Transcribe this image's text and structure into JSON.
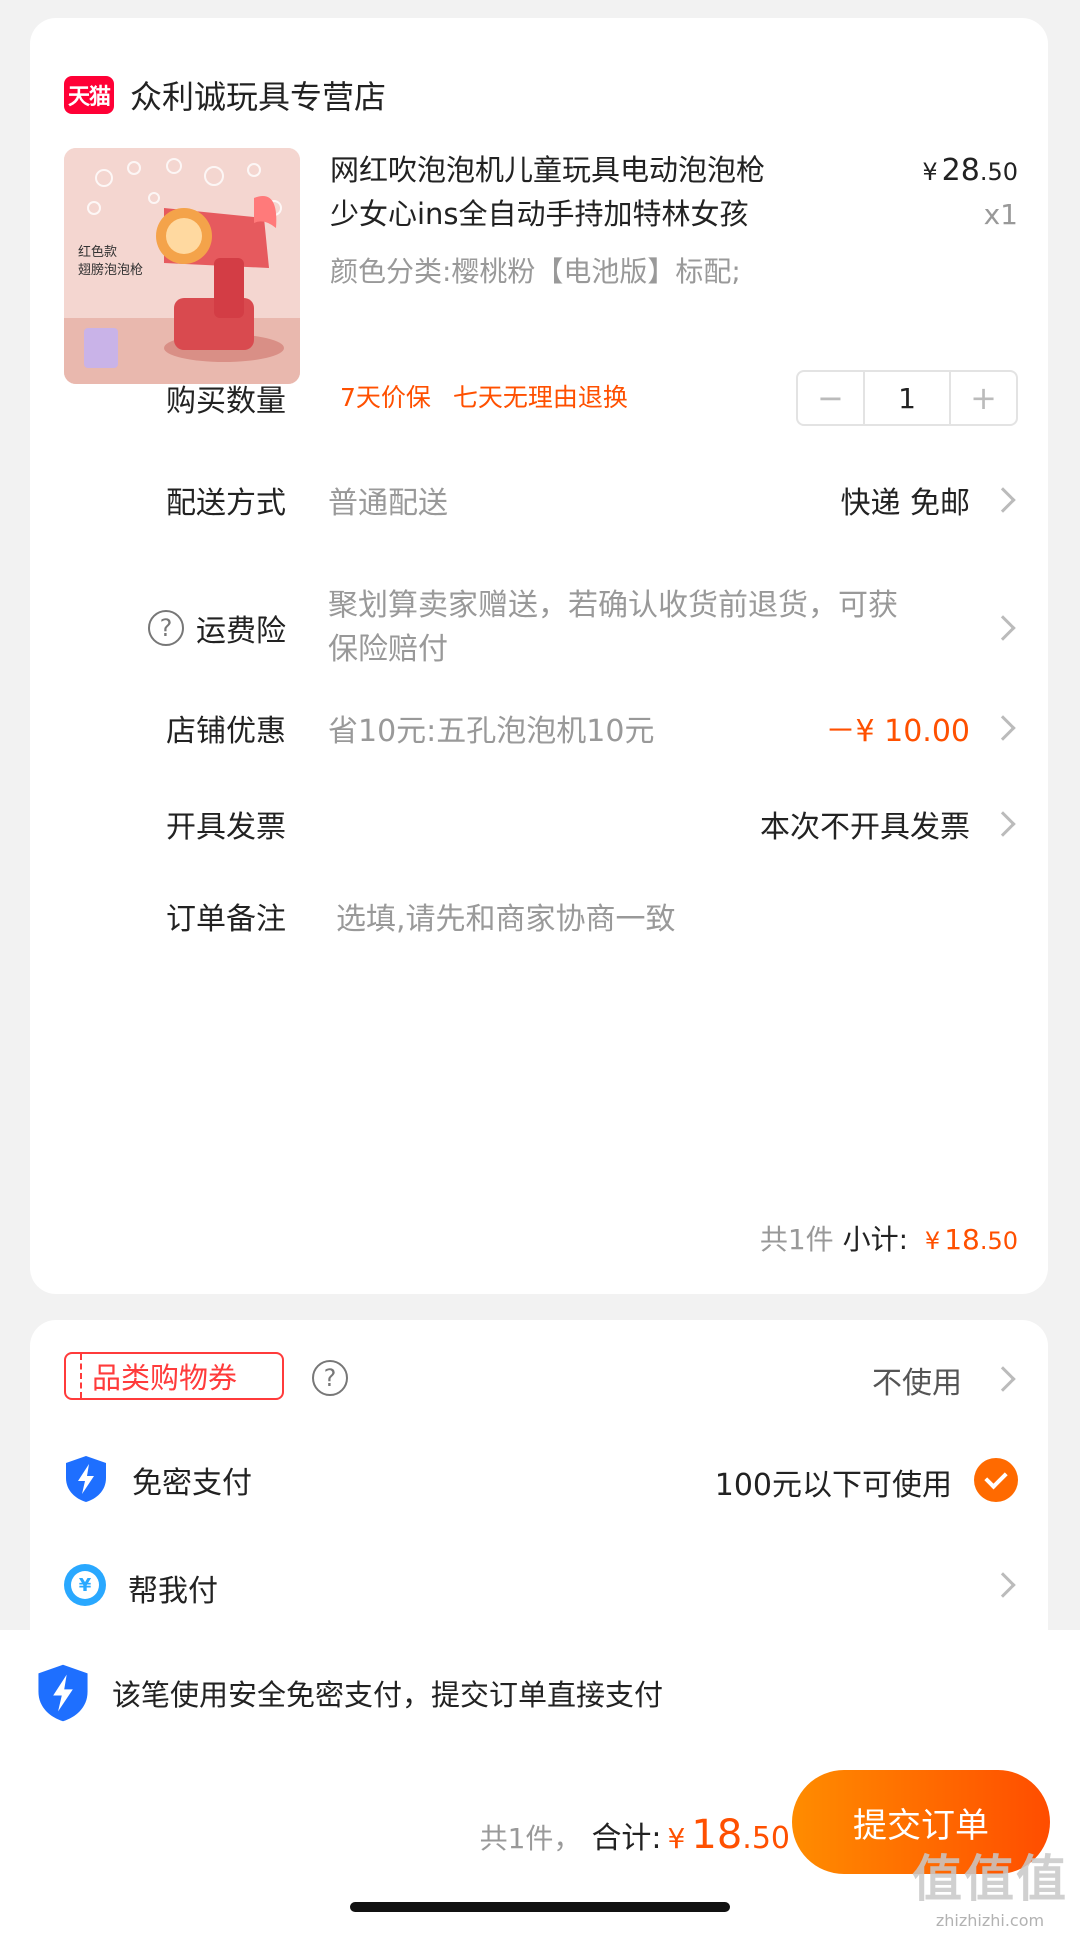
{
  "store": {
    "badge": "天猫",
    "name": "众利诚玩具专营店"
  },
  "product": {
    "title": "网红吹泡泡机儿童玩具电动泡泡枪少女心ins全自动手持加特林女孩",
    "price_yen": "¥",
    "price_main": "28",
    "price_decimal": ".50",
    "quantity_label": "x1",
    "spec": "颜色分类:樱桃粉【电池版】标配;",
    "tags": [
      "7天价保",
      "七天无理由退换"
    ],
    "image_text_1": "红色款",
    "image_text_2": "翅膀泡泡枪"
  },
  "rows": {
    "quantity": {
      "label": "购买数量",
      "value": "1",
      "minus": "−",
      "plus": "+"
    },
    "delivery": {
      "label": "配送方式",
      "sub": "普通配送",
      "value": "快递 免邮"
    },
    "insurance": {
      "label": "运费险",
      "sub_line1": "聚划算卖家赠送，若确认收货前退货，可获",
      "sub_line2": "保险赔付"
    },
    "discount": {
      "label": "店铺优惠",
      "sub": "省10元:五孔泡泡机10元",
      "value": "－¥ 10.00",
      "color": "#ff5000"
    },
    "invoice": {
      "label": "开具发票",
      "value": "本次不开具发票"
    },
    "note": {
      "label": "订单备注",
      "placeholder": "选填,请先和商家协商一致"
    }
  },
  "subtotal": {
    "count": "共1件",
    "label": "小计:",
    "yen": "¥",
    "main": "18",
    "decimal": ".50"
  },
  "payment": {
    "coupon": {
      "label": "品类购物券",
      "value": "不使用"
    },
    "secret_pay": {
      "label": "免密支付",
      "value": "100元以下可使用"
    },
    "help_pay": {
      "label": "帮我付",
      "icon_glyph": "¥"
    }
  },
  "bottom": {
    "notice": "该笔使用安全免密支付，提交订单直接支付",
    "count": "共1件，",
    "total_label": "合计:",
    "yen": "¥",
    "total_main": "18",
    "total_decimal": ".50",
    "submit": "提交订单"
  },
  "watermark": {
    "big": "值值值",
    "small": "zhizhizhi.com"
  },
  "colors": {
    "accent": "#ff5000",
    "tmall": "#ff0036",
    "shield": "#1e6fff"
  }
}
